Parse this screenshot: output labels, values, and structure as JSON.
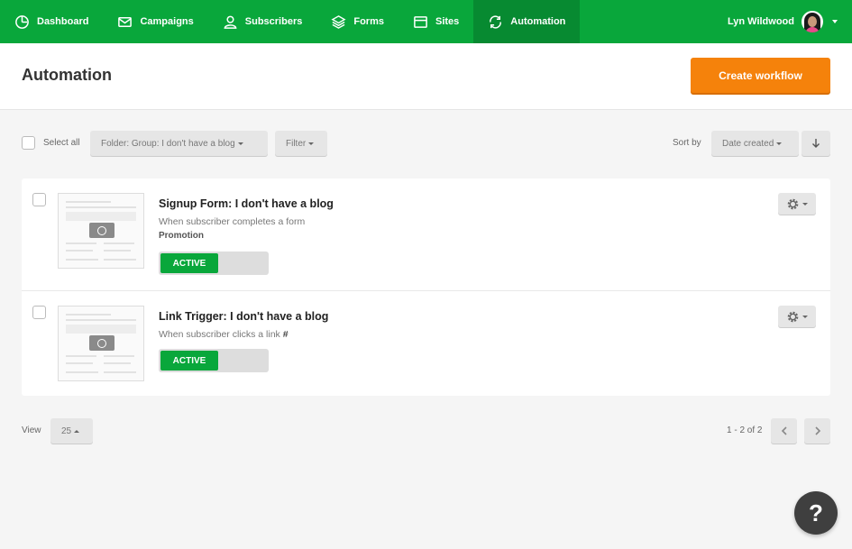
{
  "nav": {
    "items": [
      {
        "label": "Dashboard",
        "icon": "dashboard-icon"
      },
      {
        "label": "Campaigns",
        "icon": "envelope-icon"
      },
      {
        "label": "Subscribers",
        "icon": "user-icon"
      },
      {
        "label": "Forms",
        "icon": "layers-icon"
      },
      {
        "label": "Sites",
        "icon": "browser-icon"
      },
      {
        "label": "Automation",
        "icon": "sync-icon",
        "active": true
      }
    ],
    "user_name": "Lyn Wildwood"
  },
  "header": {
    "title": "Automation",
    "create_label": "Create workflow"
  },
  "toolbar": {
    "select_all_label": "Select all",
    "folder_label": "Folder: Group: I don't have a blog",
    "filter_label": "Filter",
    "sort_by_label": "Sort by",
    "sort_value": "Date created"
  },
  "workflows": [
    {
      "title": "Signup Form: I don't have a blog",
      "description": "When subscriber completes a form",
      "tag": "Promotion",
      "status": "ACTIVE"
    },
    {
      "title": "Link Trigger: I don't have a blog",
      "description": "When subscriber clicks a link",
      "hash": "#",
      "status": "ACTIVE"
    }
  ],
  "footer": {
    "view_label": "View",
    "per_page": "25",
    "pagination": "1 - 2 of 2"
  },
  "help_label": "?",
  "colors": {
    "brand_green": "#09a73b",
    "brand_green_active": "#078a31",
    "accent_orange": "#f5820b"
  }
}
